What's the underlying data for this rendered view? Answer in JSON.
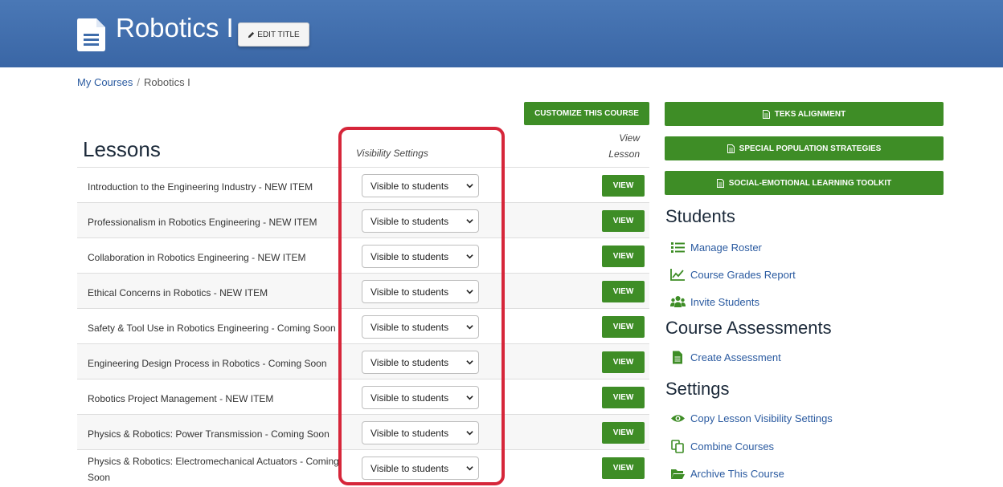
{
  "header": {
    "title": "Robotics I",
    "edit_title_label": "EDIT TITLE"
  },
  "breadcrumb": {
    "home": "My Courses",
    "separator": "/",
    "current": "Robotics I"
  },
  "customize_label": "CUSTOMIZE THIS COURSE",
  "lessons_section": {
    "title": "Lessons",
    "visibility_header": "Visibility Settings",
    "view_header_line1": "View",
    "view_header_line2": "Lesson",
    "view_label": "VIEW",
    "items": [
      {
        "name": "Introduction to the Engineering Industry - NEW ITEM",
        "visibility": "Visible to students"
      },
      {
        "name": "Professionalism in Robotics Engineering - NEW ITEM",
        "visibility": "Visible to students"
      },
      {
        "name": "Collaboration in Robotics Engineering - NEW ITEM",
        "visibility": "Visible to students"
      },
      {
        "name": "Ethical Concerns in Robotics - NEW ITEM",
        "visibility": "Visible to students"
      },
      {
        "name": "Safety & Tool Use in Robotics Engineering - Coming Soon",
        "visibility": "Visible to students"
      },
      {
        "name": "Engineering Design Process in Robotics - Coming Soon",
        "visibility": "Visible to students"
      },
      {
        "name": "Robotics Project Management - NEW ITEM",
        "visibility": "Visible to students"
      },
      {
        "name": "Physics & Robotics: Power Transmission - Coming Soon",
        "visibility": "Visible to students"
      },
      {
        "name": "Physics & Robotics: Electromechanical Actuators - Coming Soon",
        "visibility": "Visible to students"
      }
    ]
  },
  "sidebar": {
    "buttons": [
      {
        "label": "TEKS ALIGNMENT",
        "icon": "document-icon"
      },
      {
        "label": "SPECIAL POPULATION STRATEGIES",
        "icon": "document-icon"
      },
      {
        "label": "SOCIAL-EMOTIONAL LEARNING TOOLKIT",
        "icon": "document-icon"
      }
    ],
    "students": {
      "title": "Students",
      "links": [
        {
          "label": "Manage Roster",
          "icon": "list-icon"
        },
        {
          "label": "Course Grades Report",
          "icon": "line-chart-icon"
        },
        {
          "label": "Invite Students",
          "icon": "users-icon"
        }
      ]
    },
    "assessments": {
      "title": "Course Assessments",
      "links": [
        {
          "label": "Create Assessment",
          "icon": "file-text-icon"
        }
      ]
    },
    "settings": {
      "title": "Settings",
      "links": [
        {
          "label": "Copy Lesson Visibility Settings",
          "icon": "eye-icon"
        },
        {
          "label": "Combine Courses",
          "icon": "copy-icon"
        },
        {
          "label": "Archive This Course",
          "icon": "folder-open-icon"
        }
      ]
    }
  },
  "colors": {
    "header_blue": "#3f6dab",
    "button_green": "#3e8d26",
    "link_blue": "#2a5aa0",
    "highlight_red": "#d6263a"
  }
}
